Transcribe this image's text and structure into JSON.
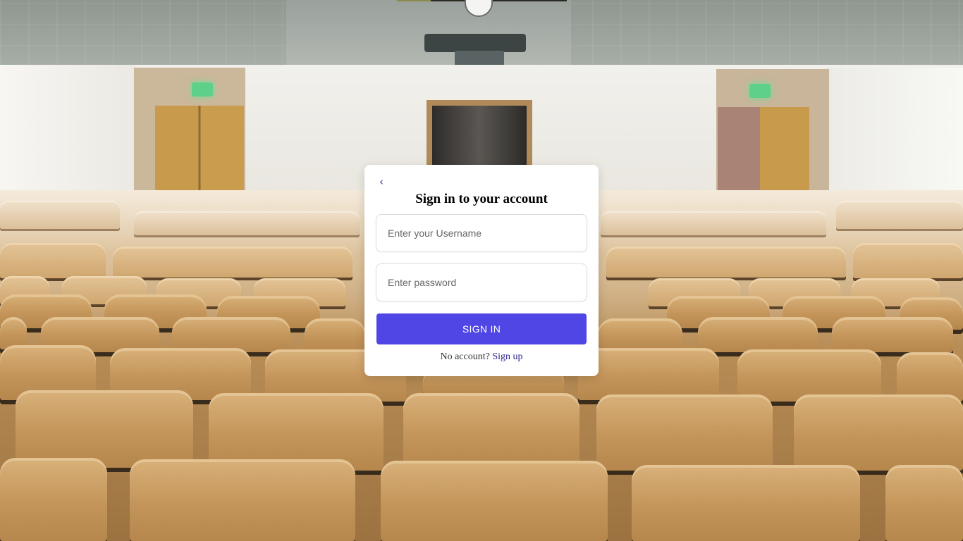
{
  "background": {
    "description_icon": "lecture-hall-photo"
  },
  "login": {
    "back_icon": "chevron-left-icon",
    "back_glyph": "‹",
    "title": "Sign in to your account",
    "username_placeholder": "Enter your Username",
    "username_value": "",
    "password_placeholder": "Enter password",
    "password_value": "",
    "submit_label": "SIGN IN",
    "no_account_text": "No account?",
    "signup_link": "Sign up"
  },
  "colors": {
    "accent": "#4f46e5",
    "link": "#2b2590",
    "card_bg": "#ffffff"
  }
}
